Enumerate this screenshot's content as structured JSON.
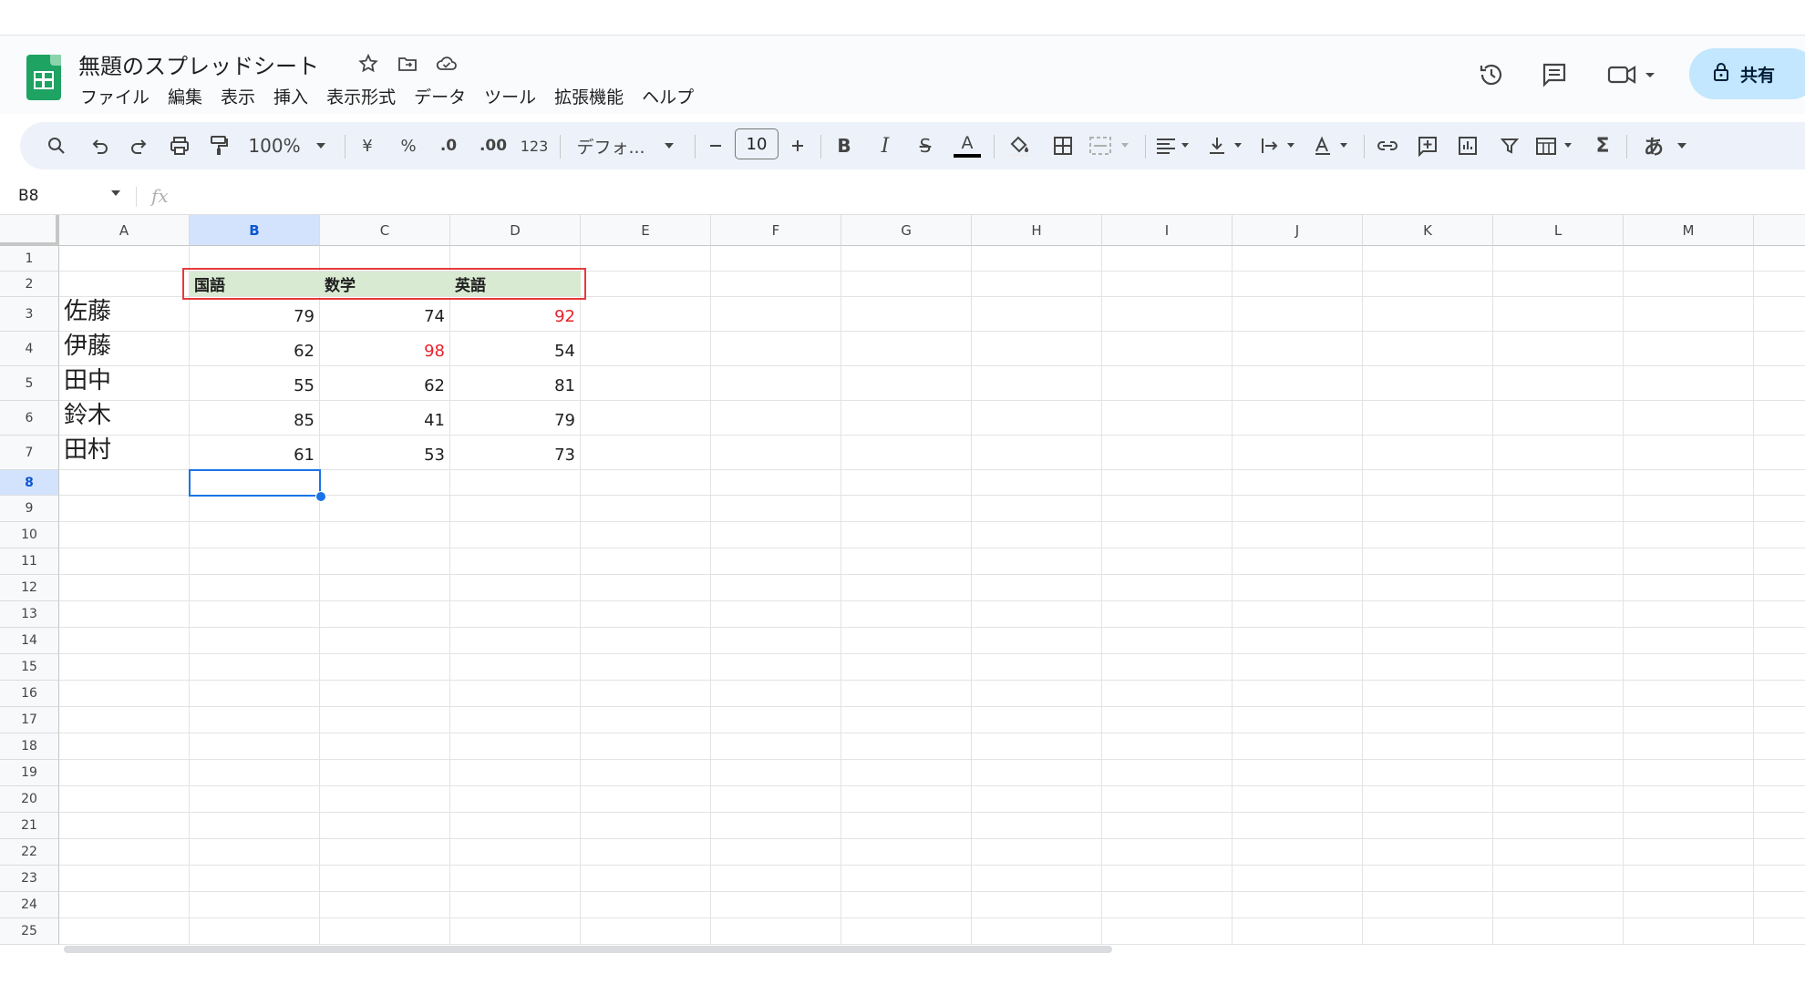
{
  "document": {
    "title": "無題のスプレッドシート",
    "share_label": "共有"
  },
  "menu": [
    "ファイル",
    "編集",
    "表示",
    "挿入",
    "表示形式",
    "データ",
    "ツール",
    "拡張機能",
    "ヘルプ"
  ],
  "toolbar": {
    "zoom": "100%",
    "currency": "¥",
    "percent": "%",
    "decrease_decimal": ".0",
    "increase_decimal": ".00",
    "number_format": "123",
    "font": "デフォ...",
    "font_size": "10",
    "bold": "B",
    "italic": "I",
    "strikethrough": "S",
    "text_color": "A",
    "function": "Σ",
    "input_tools": "あ"
  },
  "formula_bar": {
    "name_box": "B8",
    "fx": "fx"
  },
  "columns": [
    "A",
    "B",
    "C",
    "D",
    "E",
    "F",
    "G",
    "H",
    "I",
    "J",
    "K",
    "L",
    "M"
  ],
  "rows": [
    "1",
    "2",
    "3",
    "4",
    "5",
    "6",
    "7",
    "8",
    "9",
    "10",
    "11",
    "12",
    "13",
    "14",
    "15",
    "16",
    "17",
    "18",
    "19",
    "20",
    "21",
    "22",
    "23",
    "24",
    "25"
  ],
  "selected_cell": "B8",
  "table": {
    "headers": [
      "国語",
      "数学",
      "英語"
    ],
    "rows": [
      {
        "name": "佐藤",
        "values": [
          "79",
          "74",
          "92"
        ],
        "highlight": [
          false,
          false,
          true
        ]
      },
      {
        "name": "伊藤",
        "values": [
          "62",
          "98",
          "54"
        ],
        "highlight": [
          false,
          true,
          false
        ]
      },
      {
        "name": "田中",
        "values": [
          "55",
          "62",
          "81"
        ],
        "highlight": [
          false,
          false,
          false
        ]
      },
      {
        "name": "鈴木",
        "values": [
          "85",
          "41",
          "79"
        ],
        "highlight": [
          false,
          false,
          false
        ]
      },
      {
        "name": "田村",
        "values": [
          "61",
          "53",
          "73"
        ],
        "highlight": [
          false,
          false,
          false
        ]
      }
    ]
  },
  "colors": {
    "header_fill": "#d9ead3",
    "highlight_text": "#e8222a",
    "selection": "#1a73e8",
    "annotation_box": "#e63a3a",
    "share_button": "#c2e7ff"
  }
}
